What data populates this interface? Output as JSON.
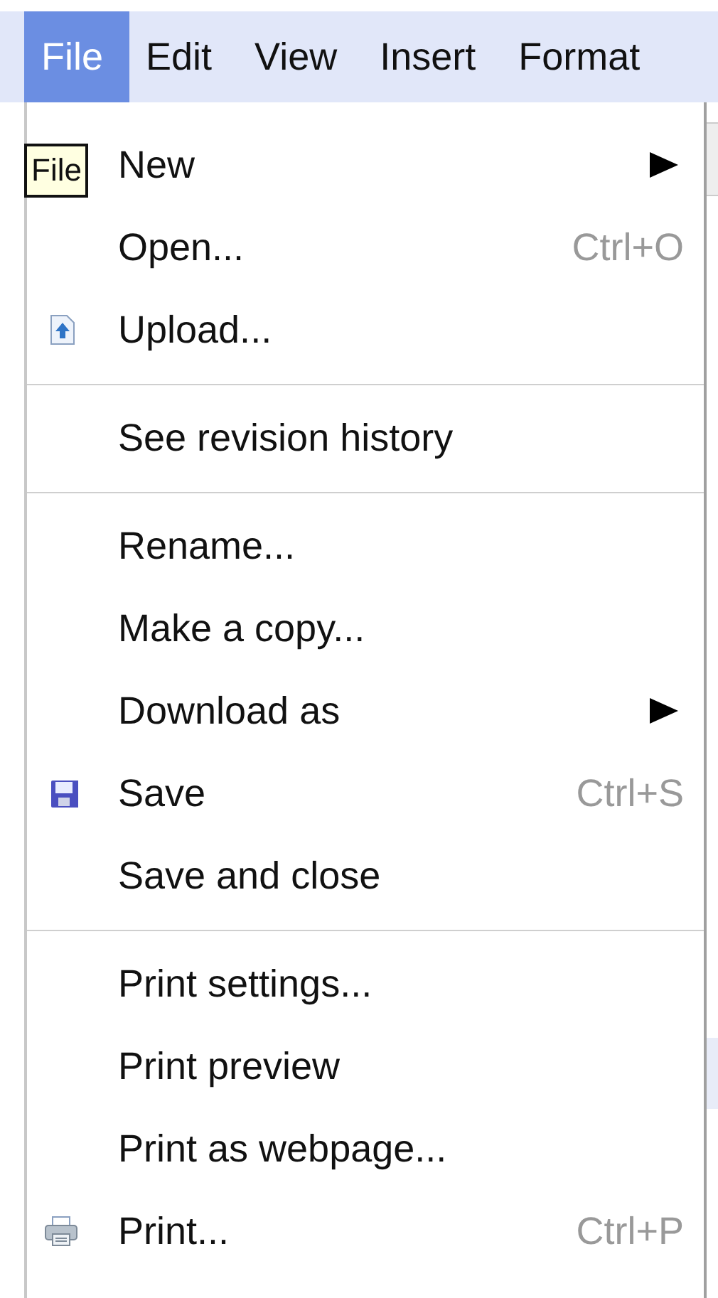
{
  "menubar": [
    {
      "label": "File",
      "selected": true
    },
    {
      "label": "Edit",
      "selected": false
    },
    {
      "label": "View",
      "selected": false
    },
    {
      "label": "Insert",
      "selected": false
    },
    {
      "label": "Format",
      "selected": false
    }
  ],
  "tooltip": "File",
  "menu": {
    "groups": [
      {
        "items": [
          {
            "label": "New",
            "submenu": true
          },
          {
            "label": "Open...",
            "shortcut": "Ctrl+O"
          },
          {
            "label": "Upload...",
            "kind": "upload"
          }
        ]
      },
      {
        "items": [
          {
            "label": "See revision history"
          }
        ]
      },
      {
        "items": [
          {
            "label": "Rename..."
          },
          {
            "label": "Make a copy..."
          },
          {
            "label": "Download as",
            "submenu": true
          },
          {
            "label": "Save",
            "shortcut": "Ctrl+S",
            "kind": "save"
          },
          {
            "label": "Save and close"
          }
        ]
      },
      {
        "items": [
          {
            "label": "Print settings..."
          },
          {
            "label": "Print preview"
          },
          {
            "label": "Print as webpage..."
          },
          {
            "label": "Print...",
            "shortcut": "Ctrl+P",
            "kind": "print"
          }
        ]
      }
    ]
  }
}
